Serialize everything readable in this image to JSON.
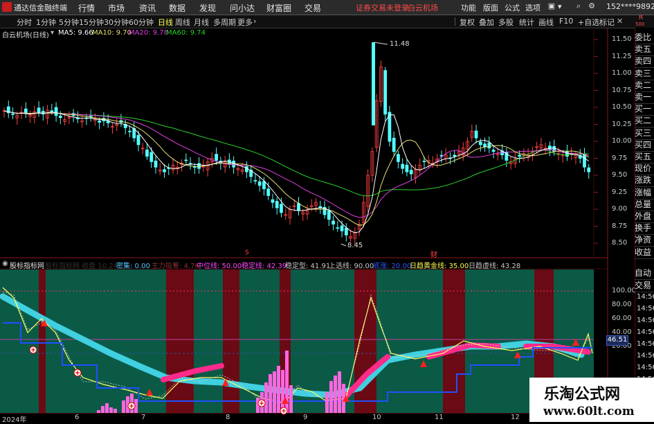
{
  "titlebar": {
    "app_name": "通达信金融终端",
    "menus": [
      "行情",
      "市场",
      "资讯",
      "数据",
      "发现",
      "问小达",
      "财富圈",
      "交易"
    ],
    "notice": "证券交易未登录",
    "stock_link": "白云机场",
    "right_menus": [
      "功能",
      "版面",
      "公式",
      "选项"
    ],
    "user": "152****9892"
  },
  "toolbar": {
    "periods": [
      "分时",
      "1分钟",
      "5分钟",
      "15分钟",
      "30分钟",
      "60分钟",
      "日线",
      "周线",
      "月线",
      "多周期",
      "更多"
    ],
    "active_period": "日线",
    "right_items": [
      "复权",
      "叠加",
      "多股",
      "统计",
      "画线",
      "F10",
      "+自选",
      "标记"
    ],
    "r_badge": "R",
    "r_badge_num": "500"
  },
  "main_chart": {
    "stock_title": "白云机场(日线)",
    "ma5": "MA5: 9.66",
    "ma10": "MA10: 9.70",
    "ma20": "MA20: 9.78",
    "ma60": "MA60: 9.74",
    "high_label": "11.48",
    "low_label": "8.45",
    "marker_s": "S",
    "marker_cai": "财",
    "price_axis": [
      "11.50",
      "11.25",
      "11.00",
      "10.75",
      "10.50",
      "10.25",
      "10.00",
      "9.75",
      "9.50",
      "9.25",
      "9.00",
      "8.75",
      "8.50"
    ]
  },
  "indicator": {
    "name": "股标指标网",
    "faded_text": "股标指标网 收盘 10.24",
    "items": [
      {
        "text": "密集: 0.00",
        "color": "#55c8ff"
      },
      {
        "text": "主力吸筹: 4.76",
        "color": "#8a3030"
      },
      {
        "text": "中位线: 50.00",
        "color": "#ff4aff"
      },
      {
        "text": "稳定线: 42.39",
        "color": "#ff4aff"
      },
      {
        "text": "稳定型: 41.91",
        "color": "#c8c8c8"
      },
      {
        "text": "上选线: 90.00",
        "color": "#c8c8c8"
      },
      {
        "text": "底涨: 20.00",
        "color": "#2a5aff"
      },
      {
        "text": "日趋黄金线: 35.00",
        "color": "#ffff54"
      },
      {
        "text": "日趋虚线: 43.28",
        "color": "#c8c8c8"
      }
    ],
    "axis": [
      "100.00",
      "80.00",
      "60.00",
      "40.00",
      "20.00"
    ],
    "current_value": "46.51"
  },
  "dates": [
    "2024年",
    "6",
    "7",
    "8",
    "9",
    "10",
    "11",
    "12"
  ],
  "right_panel": {
    "top_items": [
      "委比",
      "卖五",
      "卖四",
      "卖三",
      "卖二",
      "卖一",
      "买一",
      "买二",
      "买三",
      "买四",
      "买五",
      "现价",
      "涨跌",
      "涨幅",
      "总量",
      "外盘",
      "换手",
      "净资",
      "收益"
    ],
    "bottom_items": [
      "自动",
      "交易"
    ],
    "times": [
      "14:56",
      "14:56",
      "14:56",
      "14:56",
      "14:56",
      "14:56",
      "14:56",
      "14:56"
    ]
  },
  "watermark": {
    "line1": "乐淘公式网",
    "line2": "www.60lt.com"
  }
}
